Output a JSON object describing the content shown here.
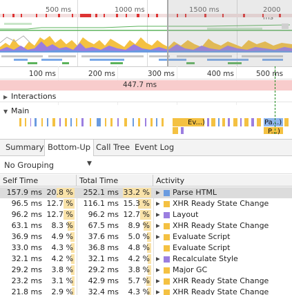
{
  "overview": {
    "ticks": [
      "500 ms",
      "1000 ms",
      "1500 ms",
      "2000 ms"
    ]
  },
  "timeline": {
    "ruler_ticks": [
      "100 ms",
      "200 ms",
      "300 ms",
      "400 ms",
      "500 ms"
    ],
    "frame_label": "447.7 ms",
    "tracks": {
      "interactions": "Interactions",
      "main": "Main"
    },
    "flame_labels": [
      "Ev...)",
      "Pa...)",
      "P...)"
    ]
  },
  "tabs": [
    "Summary",
    "Bottom-Up",
    "Call Tree",
    "Event Log"
  ],
  "active_tab": "Bottom-Up",
  "grouping": {
    "selected": "No Grouping"
  },
  "table": {
    "headers": {
      "self_time": "Self Time",
      "total_time": "Total Time",
      "activity": "Activity"
    },
    "rows": [
      {
        "self": "157.9 ms",
        "self_pct": "20.8 %",
        "total": "252.1 ms",
        "total_pct": "33.2 %",
        "activity": "Parse HTML",
        "color": "#6a9be0",
        "expandable": true,
        "self_frac": 0.208,
        "total_frac": 0.332
      },
      {
        "self": "96.5 ms",
        "self_pct": "12.7 %",
        "total": "116.1 ms",
        "total_pct": "15.3 %",
        "activity": "XHR Ready State Change",
        "color": "#f4c142",
        "expandable": true,
        "self_frac": 0.127,
        "total_frac": 0.153
      },
      {
        "self": "96.2 ms",
        "self_pct": "12.7 %",
        "total": "96.2 ms",
        "total_pct": "12.7 %",
        "activity": "Layout",
        "color": "#9b7ee0",
        "expandable": true,
        "self_frac": 0.127,
        "total_frac": 0.127
      },
      {
        "self": "63.1 ms",
        "self_pct": "8.3 %",
        "total": "67.5 ms",
        "total_pct": "8.9 %",
        "activity": "XHR Ready State Change",
        "color": "#f4c142",
        "expandable": true,
        "self_frac": 0.083,
        "total_frac": 0.089
      },
      {
        "self": "36.9 ms",
        "self_pct": "4.9 %",
        "total": "37.6 ms",
        "total_pct": "5.0 %",
        "activity": "Evaluate Script",
        "color": "#f4c142",
        "expandable": true,
        "self_frac": 0.049,
        "total_frac": 0.05
      },
      {
        "self": "33.0 ms",
        "self_pct": "4.3 %",
        "total": "36.8 ms",
        "total_pct": "4.8 %",
        "activity": "Evaluate Script",
        "color": "#f4c142",
        "expandable": false,
        "self_frac": 0.043,
        "total_frac": 0.048
      },
      {
        "self": "32.1 ms",
        "self_pct": "4.2 %",
        "total": "32.1 ms",
        "total_pct": "4.2 %",
        "activity": "Recalculate Style",
        "color": "#9b7ee0",
        "expandable": true,
        "self_frac": 0.042,
        "total_frac": 0.042
      },
      {
        "self": "29.2 ms",
        "self_pct": "3.8 %",
        "total": "29.2 ms",
        "total_pct": "3.8 %",
        "activity": "Major GC",
        "color": "#f4c142",
        "expandable": true,
        "self_frac": 0.038,
        "total_frac": 0.038
      },
      {
        "self": "23.2 ms",
        "self_pct": "3.1 %",
        "total": "42.9 ms",
        "total_pct": "5.7 %",
        "activity": "XHR Ready State Change",
        "color": "#f4c142",
        "expandable": true,
        "self_frac": 0.031,
        "total_frac": 0.057
      },
      {
        "self": "21.8 ms",
        "self_pct": "2.9 %",
        "total": "32.4 ms",
        "total_pct": "4.3 %",
        "activity": "XHR Ready State Change",
        "color": "#f4c142",
        "expandable": true,
        "self_frac": 0.029,
        "total_frac": 0.043
      }
    ]
  }
}
